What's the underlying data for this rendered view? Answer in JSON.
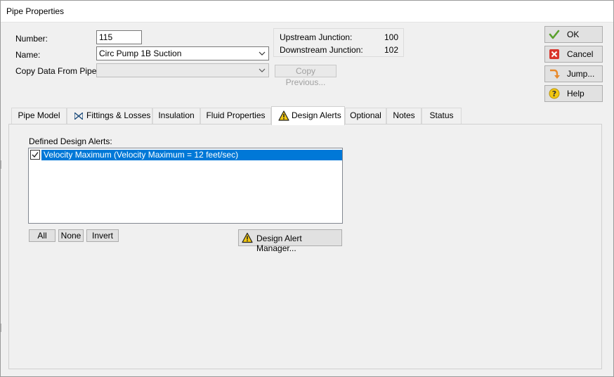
{
  "window": {
    "title": "Pipe Properties"
  },
  "form": {
    "number_label": "Number:",
    "number_value": "115",
    "name_label": "Name:",
    "name_value": "Circ Pump 1B Suction",
    "copy_label": "Copy Data From Pipe...",
    "copy_value": "",
    "copy_previous_label": "Copy Previous..."
  },
  "junctions": {
    "upstream_label": "Upstream Junction:",
    "upstream_value": "100",
    "downstream_label": "Downstream Junction:",
    "downstream_value": "102"
  },
  "side_buttons": {
    "ok": "OK",
    "cancel": "Cancel",
    "jump": "Jump...",
    "help": "Help"
  },
  "tabs": [
    {
      "label": "Pipe Model"
    },
    {
      "label": "Fittings & Losses"
    },
    {
      "label": "Insulation"
    },
    {
      "label": "Fluid Properties"
    },
    {
      "label": "Design Alerts"
    },
    {
      "label": "Optional"
    },
    {
      "label": "Notes"
    },
    {
      "label": "Status"
    }
  ],
  "active_tab": "Design Alerts",
  "design_alerts": {
    "defined_label": "Defined Design Alerts:",
    "items": [
      {
        "label": "Velocity Maximum (Velocity Maximum = 12 feet/sec)",
        "checked": true
      }
    ],
    "all_button": "All",
    "none_button": "None",
    "invert_button": "Invert",
    "manager_button": "Design Alert Manager..."
  },
  "colors": {
    "selection": "#0078d7",
    "ok_check": "#5aa02c",
    "cancel_red": "#d9342b",
    "warning_yellow": "#f2c811"
  },
  "icons": {
    "ok": "check-icon",
    "cancel": "close-icon",
    "jump": "jump-arrow-icon",
    "help": "help-icon",
    "fittings": "valve-icon",
    "design_alerts": "warning-icon"
  }
}
